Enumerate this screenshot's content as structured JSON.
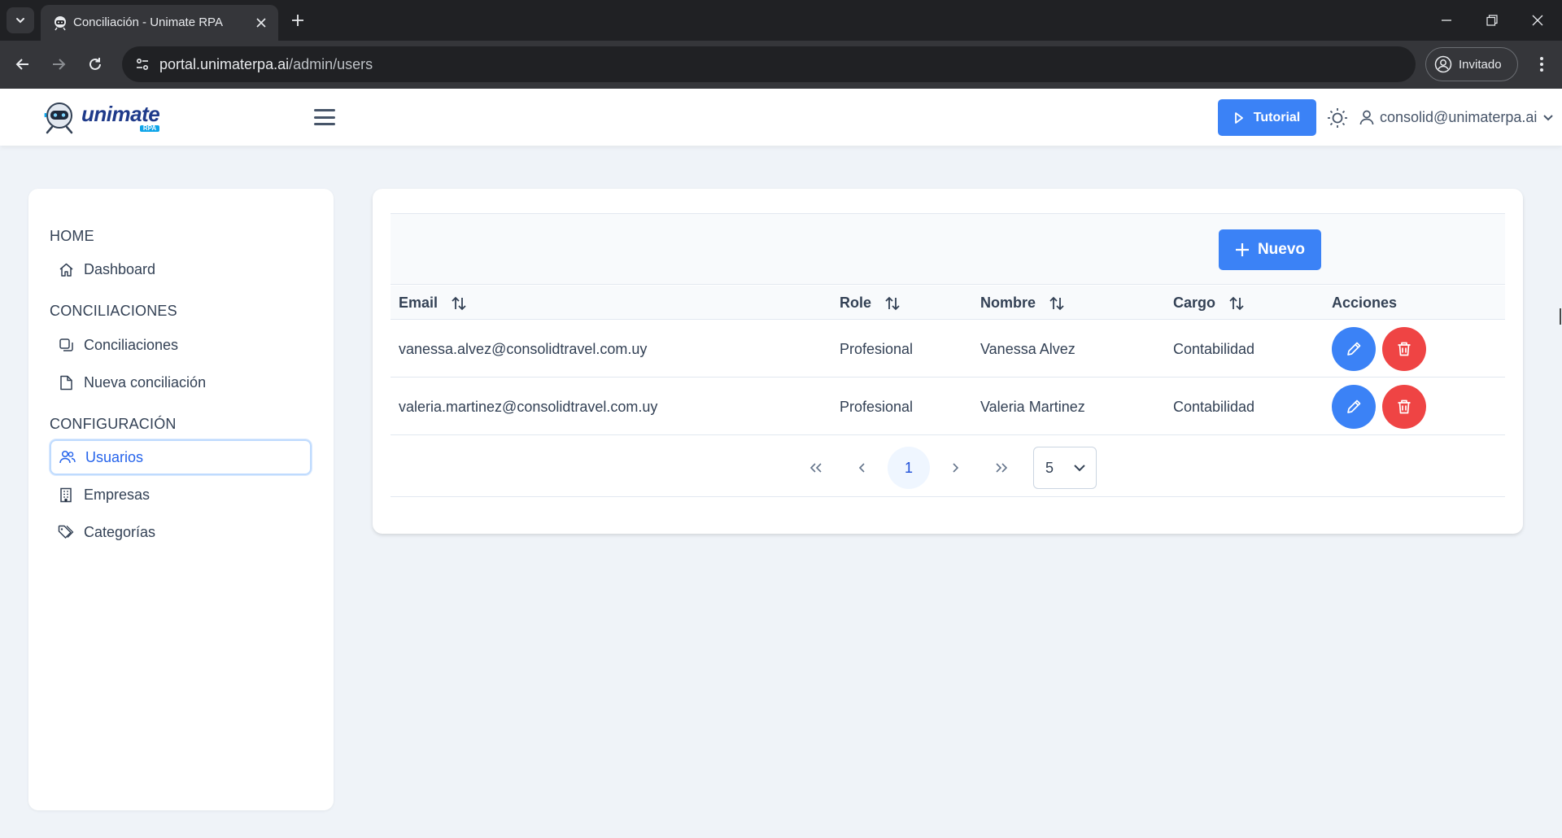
{
  "browser": {
    "tab_title": "Conciliación - Unimate RPA",
    "url_host": "portal.unimaterpa.ai",
    "url_path": "/admin/users",
    "profile_label": "Invitado"
  },
  "header": {
    "logo_text": "unimate",
    "logo_sub": "RPA",
    "tutorial_label": "Tutorial",
    "user_email": "consolid@unimaterpa.ai"
  },
  "sidebar": {
    "sections": [
      {
        "title": "HOME",
        "items": [
          {
            "label": "Dashboard",
            "icon": "home-icon"
          }
        ]
      },
      {
        "title": "CONCILIACIONES",
        "items": [
          {
            "label": "Conciliaciones",
            "icon": "copy-icon"
          },
          {
            "label": "Nueva conciliación",
            "icon": "file-icon"
          }
        ]
      },
      {
        "title": "CONFIGURACIÓN",
        "items": [
          {
            "label": "Usuarios",
            "icon": "users-icon",
            "active": true
          },
          {
            "label": "Empresas",
            "icon": "building-icon"
          },
          {
            "label": "Categorías",
            "icon": "tags-icon"
          }
        ]
      }
    ]
  },
  "table": {
    "new_label": "Nuevo",
    "columns": {
      "email": "Email",
      "role": "Role",
      "nombre": "Nombre",
      "cargo": "Cargo",
      "acciones": "Acciones"
    },
    "rows": [
      {
        "email": "vanessa.alvez@consolidtravel.com.uy",
        "role": "Profesional",
        "nombre": "Vanessa Alvez",
        "cargo": "Contabilidad"
      },
      {
        "email": "valeria.martinez@consolidtravel.com.uy",
        "role": "Profesional",
        "nombre": "Valeria Martinez",
        "cargo": "Contabilidad"
      }
    ],
    "pagination": {
      "current_page": "1",
      "rows_per_page": "5"
    }
  },
  "colors": {
    "primary": "#3b82f6",
    "danger": "#ef4444",
    "background": "#eff3f8",
    "chrome_dark": "#202124"
  }
}
